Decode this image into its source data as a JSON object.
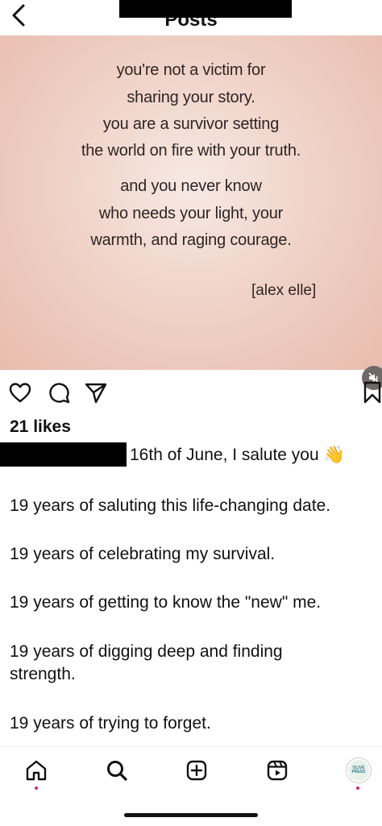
{
  "header": {
    "title": "Posts"
  },
  "post": {
    "quote_lines": [
      "you're not a victim for",
      "sharing your story.",
      "you are a survivor setting",
      "the world on fire with your truth.",
      "and you never know",
      "who needs your light, your",
      "warmth, and raging courage."
    ],
    "attribution": "[alex elle]"
  },
  "engagement": {
    "likes": "21 likes"
  },
  "caption": {
    "first_line": "16th of June, I salute you 👋",
    "paragraphs": [
      "19 years of saluting this life-changing date.",
      "19 years of celebrating my survival.",
      "19 years of getting to know the \"new\" me.",
      "19 years of digging deep and finding strength.",
      "19 years of trying to forget."
    ]
  },
  "bottom_nav": {
    "items": [
      "home-icon",
      "search-icon",
      "create-icon",
      "reels-icon",
      "profile-avatar"
    ]
  },
  "avatar_label": "OLIVE PRESS"
}
